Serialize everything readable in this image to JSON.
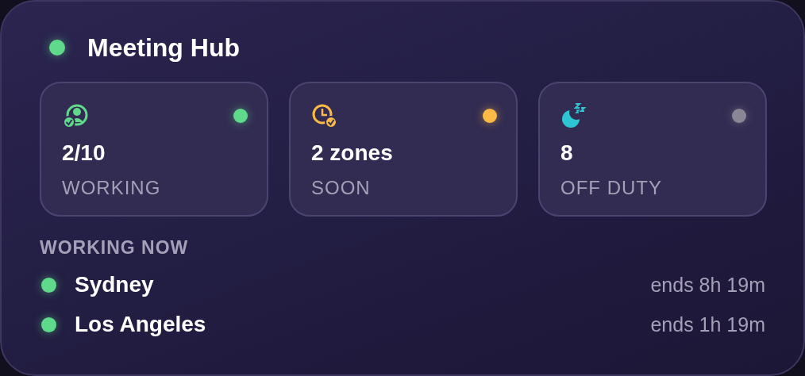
{
  "header": {
    "title": "Meeting Hub"
  },
  "stats": [
    {
      "kind": "working",
      "value": "2/10",
      "label": "WORKING",
      "color": "#5fd98a"
    },
    {
      "kind": "soon",
      "value": "2 zones",
      "label": "SOON",
      "color": "#fbb945"
    },
    {
      "kind": "off",
      "value": "8",
      "label": "OFF DUTY",
      "color": "#8a8694"
    }
  ],
  "section_title": "WORKING NOW",
  "zones": [
    {
      "city": "Sydney",
      "ends": "ends 8h 19m",
      "color": "#5fd98a"
    },
    {
      "city": "Los Angeles",
      "ends": "ends 1h 19m",
      "color": "#5fd98a"
    }
  ]
}
